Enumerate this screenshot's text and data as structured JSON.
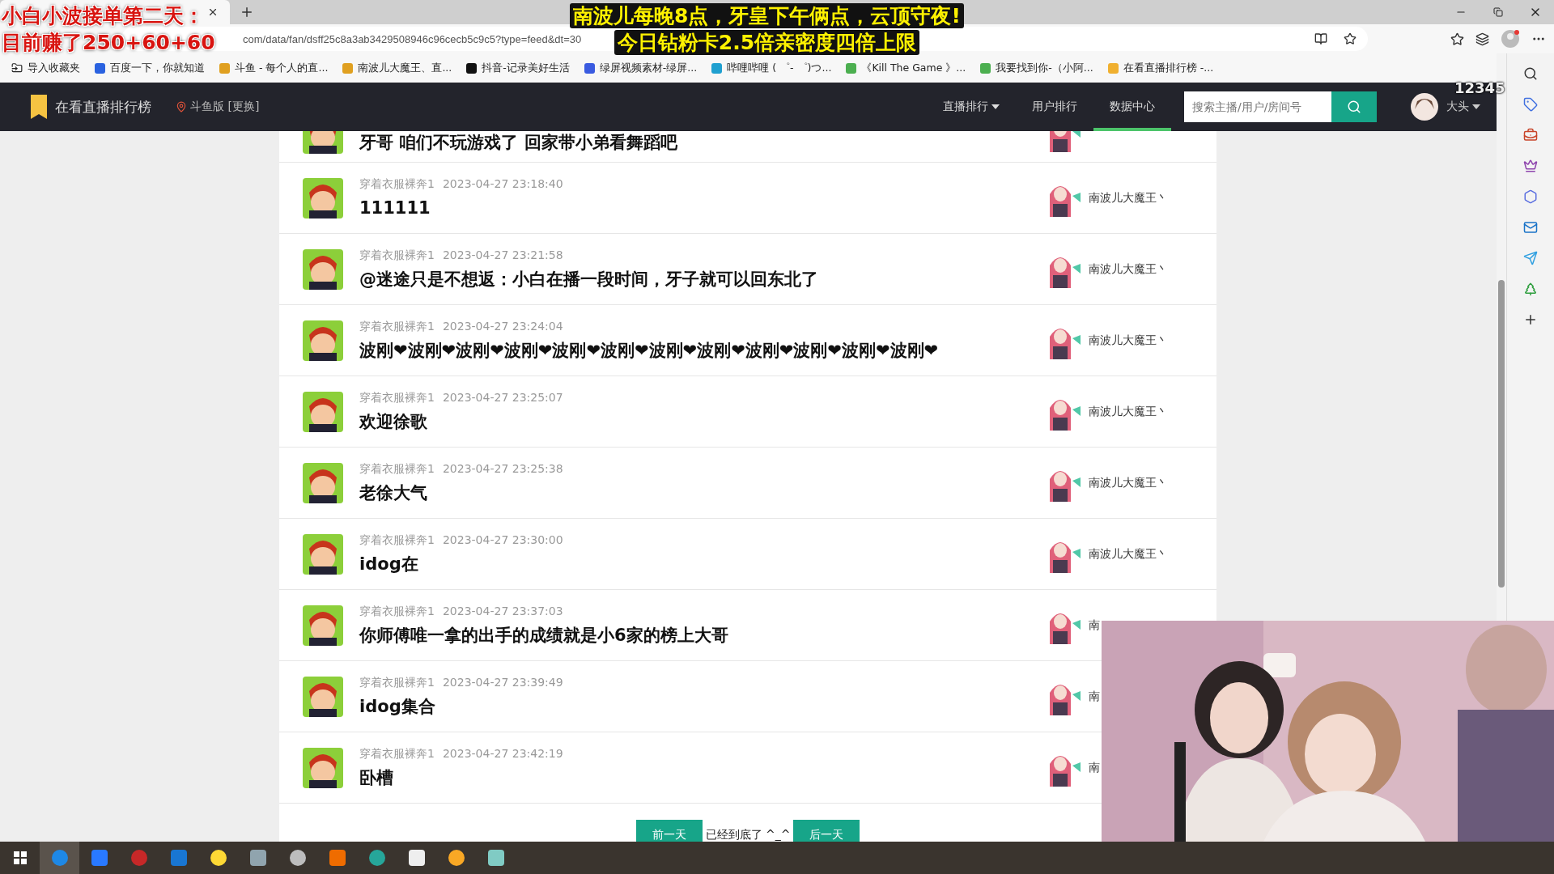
{
  "stream_overlay": {
    "left_lines": [
      "小白小波接单第二天：",
      "目前赚了250+60+60"
    ],
    "center_lines": [
      "南波儿每晚8点，牙皇下午俩点，云顶守夜!",
      "今日钻粉卡2.5倍亲密度四倍上限"
    ],
    "corner_text": "12345"
  },
  "browser": {
    "address": "com/data/fan/dsff25c8a3ab3429508946c96cecb5c9c5?type=feed&dt=30",
    "bookmarks": [
      "导入收藏夹",
      "百度一下，你就知道",
      "斗鱼 - 每个人的直...",
      "南波儿大魔王、直...",
      "抖音-记录美好生活",
      "绿屏视频素材-绿屏...",
      "哔哩哔哩 ( ゜- ゜)つ...",
      "《Kill The Game 》...",
      "我要找到你-（小阿...",
      "在看直播排行榜 -..."
    ]
  },
  "site": {
    "brand": "在看直播排行榜",
    "platform": "斗鱼版 [更换]",
    "nav": [
      {
        "label": "直播排行",
        "dropdown": true,
        "selected": false
      },
      {
        "label": "用户排行",
        "dropdown": false,
        "selected": false
      },
      {
        "label": "数据中心",
        "dropdown": false,
        "selected": true
      }
    ],
    "search": {
      "placeholder": "搜索主播/用户/房间号"
    },
    "user": "大头"
  },
  "feed": [
    {
      "message": "牙哥  咱们不玩游戏了  回家带小弟看舞蹈吧",
      "partial": true
    },
    {
      "user": "穿着衣服裸奔1",
      "time": "2023-04-27 23:18:40",
      "message": "111111",
      "anchor": "南波儿大魔王丶"
    },
    {
      "user": "穿着衣服裸奔1",
      "time": "2023-04-27 23:21:58",
      "message": "@迷途只是不想返：小白在播一段时间，牙子就可以回东北了",
      "anchor": "南波儿大魔王丶"
    },
    {
      "user": "穿着衣服裸奔1",
      "time": "2023-04-27 23:24:04",
      "message": "波刚❤波刚❤波刚❤波刚❤波刚❤波刚❤波刚❤波刚❤波刚❤波刚❤波刚❤波刚❤",
      "anchor": "南波儿大魔王丶"
    },
    {
      "user": "穿着衣服裸奔1",
      "time": "2023-04-27 23:25:07",
      "message": "欢迎徐歌",
      "anchor": "南波儿大魔王丶"
    },
    {
      "user": "穿着衣服裸奔1",
      "time": "2023-04-27 23:25:38",
      "message": "老徐大气",
      "anchor": "南波儿大魔王丶"
    },
    {
      "user": "穿着衣服裸奔1",
      "time": "2023-04-27 23:30:00",
      "message": "idog在",
      "anchor": "南波儿大魔王丶"
    },
    {
      "user": "穿着衣服裸奔1",
      "time": "2023-04-27 23:37:03",
      "message": "你师傅唯一拿的出手的成绩就是小6家的榜上大哥",
      "anchor": "南"
    },
    {
      "user": "穿着衣服裸奔1",
      "time": "2023-04-27 23:39:49",
      "message": "idog集合",
      "anchor": "南"
    },
    {
      "user": "穿着衣服裸奔1",
      "time": "2023-04-27 23:42:19",
      "message": "卧槽",
      "anchor": "南"
    }
  ],
  "pager": {
    "prev": "前一天",
    "note": "已经到底了 ^_^",
    "next": "后一天"
  }
}
